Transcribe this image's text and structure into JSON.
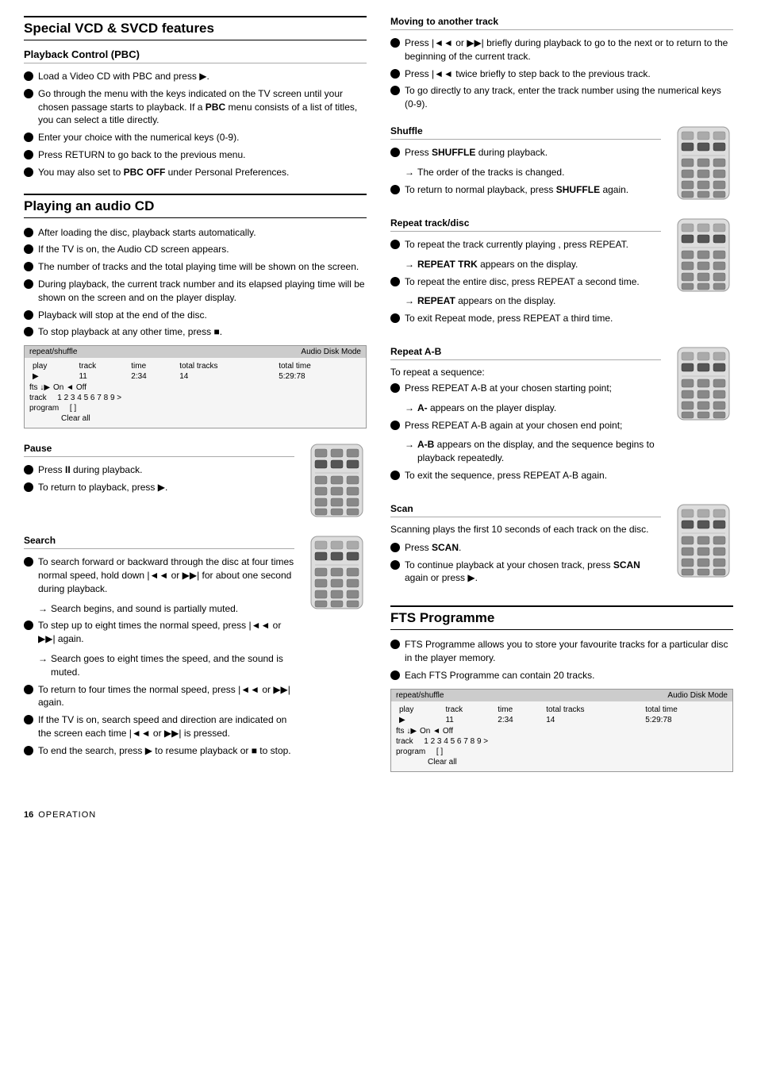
{
  "page": {
    "footer": {
      "page_number": "16",
      "section_label": "Operation"
    }
  },
  "left_col": {
    "section1": {
      "title": "Special VCD & SVCD features",
      "subsection1": {
        "title": "Playback Control (PBC)",
        "items": [
          "Load a Video CD with PBC and press ▶.",
          "Go through the menu with the keys indicated on the TV screen until your chosen passage starts to playback. If a PBC menu consists of a list of titles, you can select a title directly.",
          "Enter your choice with the numerical keys (0-9).",
          "Press RETURN to go back to the previous menu.",
          "You may also set to PBC OFF under Personal Preferences."
        ],
        "bold_words": [
          "PBC",
          "PBC OFF"
        ]
      }
    },
    "section2": {
      "title": "Playing an audio CD",
      "items": [
        "After loading the disc, playback starts automatically.",
        "If the TV is on, the Audio CD screen appears.",
        "The number of tracks and the total playing time will be shown on the screen.",
        "During playback, the current track number and its elapsed playing time will be shown on the screen and on the player display.",
        "Playback will stop at the end of the disc.",
        "To stop playback at any other time, press ■."
      ],
      "screen": {
        "header_left": "repeat/shuffle",
        "header_right": "Audio Disk Mode",
        "row1_labels": [
          "play",
          "track",
          "time",
          "total tracks",
          "total time"
        ],
        "row1_values": [
          "▶",
          "11",
          "2:34",
          "14",
          "5:29:78"
        ],
        "fts_label": "fts ↓▶",
        "fts_value": "On ◄ Off",
        "track_label": "track",
        "track_values": "1  2  3  4  5  6  7  8  9  >",
        "program_label": "program",
        "program_value": "[ ]",
        "clear_all": "Clear all"
      }
    },
    "section3": {
      "title": "Pause",
      "items": [
        "Press II during playback.",
        "To return to playback, press ▶."
      ],
      "bold_words": [
        "II"
      ]
    },
    "section4": {
      "title": "Search",
      "items": [
        {
          "text": "To search forward or backward through the disc at four times normal speed, hold down |◄◄ or ▶▶| for about one second during playback.",
          "arrow": "→ Search begins, and sound is partially muted."
        },
        {
          "text": "To step up to eight times the normal speed, press |◄◄ or ▶▶| again.",
          "arrow": "→ Search goes to eight times the speed, and the sound is muted."
        },
        {
          "text": "To return to four times the normal speed, press |◄◄ or ▶▶| again.",
          "arrow": null
        },
        {
          "text": "If the TV is on, search speed and direction are indicated on the screen each time |◄◄ or ▶▶| is pressed.",
          "arrow": null
        },
        {
          "text": "To end the search, press ▶ to resume playback or ■ to stop.",
          "arrow": null
        }
      ]
    }
  },
  "right_col": {
    "section1": {
      "title": "Moving to another track",
      "items": [
        "Press |◄◄ or ▶▶| briefly during playback to go to the next or to return to the beginning of the current track.",
        "Press |◄◄ twice briefly to step back to the previous track.",
        "To go directly to any track, enter the track number using the numerical keys (0-9)."
      ]
    },
    "section2": {
      "title": "Shuffle",
      "items": [
        {
          "text": "Press SHUFFLE during playback.",
          "arrow": "→ The order of the tracks is changed.",
          "bold": "SHUFFLE"
        },
        {
          "text": "To return to normal playback, press SHUFFLE again.",
          "arrow": null,
          "bold": "SHUFFLE"
        }
      ]
    },
    "section3": {
      "title": "Repeat track/disc",
      "items": [
        {
          "text": "To repeat the track currently playing, press REPEAT.",
          "arrow": "→ REPEAT TRK appears on the display.",
          "bold": "REPEAT"
        },
        {
          "text": "To repeat the entire disc, press REPEAT a second time.",
          "arrow": "→ REPEAT appears on the display.",
          "bold": "REPEAT"
        },
        {
          "text": "To exit Repeat mode, press REPEAT a third time.",
          "arrow": null,
          "bold": "REPEAT"
        }
      ]
    },
    "section4": {
      "title": "Repeat A-B",
      "intro": "To repeat a sequence:",
      "items": [
        {
          "text": "Press REPEAT A-B at your chosen starting point;",
          "arrow": "→ A- appears on the player display.",
          "bold": "REPEAT A-B"
        },
        {
          "text": "Press REPEAT A-B again at your chosen end point;",
          "arrow": "→ A-B appears on the display, and the sequence begins to playback repeatedly.",
          "bold": "REPEAT A-B"
        },
        {
          "text": "To exit the sequence, press REPEAT A-B again.",
          "arrow": null,
          "bold": "REPEAT A-B"
        }
      ]
    },
    "section5": {
      "title": "Scan",
      "intro": "Scanning plays the first 10 seconds of each track on the disc.",
      "items": [
        "Press SCAN.",
        "To continue playback at your chosen track, press SCAN again or press ▶."
      ],
      "bold_words": [
        "SCAN",
        "SCAN"
      ]
    },
    "section6": {
      "title": "FTS Programme",
      "items": [
        "FTS Programme allows you to store your favourite tracks for a particular disc in the player memory.",
        "Each FTS Programme can contain 20 tracks."
      ],
      "screen": {
        "header_left": "repeat/shuffle",
        "header_right": "Audio Disk Mode",
        "row1_labels": [
          "play",
          "track",
          "time",
          "total tracks",
          "total time"
        ],
        "row1_values": [
          "▶",
          "11",
          "2:34",
          "14",
          "5:29:78"
        ],
        "fts_label": "fts ↓▶",
        "fts_value": "On ◄ Off",
        "track_label": "track",
        "track_values": "1  2  3  4  5  6  7  8  9  >",
        "program_label": "program",
        "program_value": "[ ]",
        "clear_all": "Clear all"
      }
    }
  },
  "remotes": {
    "pause_remote": "remote1",
    "search_remote": "remote2",
    "shuffle_remote": "remote3",
    "repeat_remote": "remote4",
    "repeatab_remote": "remote5",
    "scan_remote": "remote6"
  }
}
